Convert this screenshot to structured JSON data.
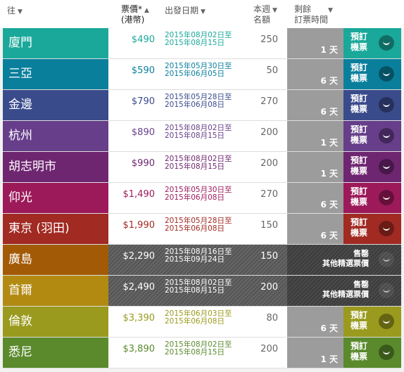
{
  "header": {
    "to": "往",
    "price": "票價*",
    "price_unit": "(港幣)",
    "depart": "出發日期",
    "week1": "本週",
    "week2": "名額",
    "remain1": "剩餘",
    "remain2": "訂票時間",
    "sort_down": "▼",
    "sort_up": "▲"
  },
  "book_label1": "預訂",
  "book_label2": "機票",
  "sold_label1": "售罄",
  "sold_label2": "其他精選票價",
  "rows": [
    {
      "dest": "廈門",
      "price": "$490",
      "d1": "2015年08月02日至",
      "d2": "2015年08月15日",
      "seats": "250",
      "days": "1 天",
      "color": "#1aa89a",
      "pcolor": "#1aa89a",
      "sold": false
    },
    {
      "dest": "三亞",
      "price": "$590",
      "d1": "2015年05月30日至",
      "d2": "2015年06月05日",
      "seats": "50",
      "days": "6 天",
      "color": "#0a7f9c",
      "pcolor": "#0a7f9c",
      "sold": false
    },
    {
      "dest": "金邊",
      "price": "$790",
      "d1": "2015年05月28日至",
      "d2": "2015年06月08日",
      "seats": "270",
      "days": "6 天",
      "color": "#3a4b8c",
      "pcolor": "#3a4b8c",
      "sold": false
    },
    {
      "dest": "杭州",
      "price": "$890",
      "d1": "2015年08月02日至",
      "d2": "2015年08月15日",
      "seats": "200",
      "days": "1 天",
      "color": "#663e8a",
      "pcolor": "#663e8a",
      "sold": false
    },
    {
      "dest": "胡志明市",
      "price": "$990",
      "d1": "2015年08月02日至",
      "d2": "2015年08月15日",
      "seats": "200",
      "days": "1 天",
      "color": "#6e2670",
      "pcolor": "#6e2670",
      "sold": false
    },
    {
      "dest": "仰光",
      "price": "$1,490",
      "d1": "2015年05月30日至",
      "d2": "2015年06月08日",
      "seats": "270",
      "days": "6 天",
      "color": "#9c1a5a",
      "pcolor": "#9c1a5a",
      "sold": false
    },
    {
      "dest": "東京 (羽田)",
      "price": "$1,990",
      "d1": "2015年05月28日至",
      "d2": "2015年06月08日",
      "seats": "150",
      "days": "6 天",
      "color": "#a12a22",
      "pcolor": "#a12a22",
      "sold": false
    },
    {
      "dest": "廣島",
      "price": "$2,290",
      "d1": "2015年08月16日至",
      "d2": "2015年09月24日",
      "seats": "150",
      "days": "",
      "color": "#a35a06",
      "pcolor": "#ffffff",
      "sold": true
    },
    {
      "dest": "首爾",
      "price": "$2,490",
      "d1": "2015年08月02日至",
      "d2": "2015年08月15日",
      "seats": "200",
      "days": "",
      "color": "#b28a12",
      "pcolor": "#ffffff",
      "sold": true
    },
    {
      "dest": "倫敦",
      "price": "$3,390",
      "d1": "2015年06月03日至",
      "d2": "2015年06月08日",
      "seats": "80",
      "days": "6 天",
      "color": "#9a9a1e",
      "pcolor": "#9a9a1e",
      "sold": false
    },
    {
      "dest": "悉尼",
      "price": "$3,890",
      "d1": "2015年08月02日至",
      "d2": "2015年08月15日",
      "seats": "200",
      "days": "1 天",
      "color": "#5a8a2c",
      "pcolor": "#5a8a2c",
      "sold": false
    }
  ]
}
